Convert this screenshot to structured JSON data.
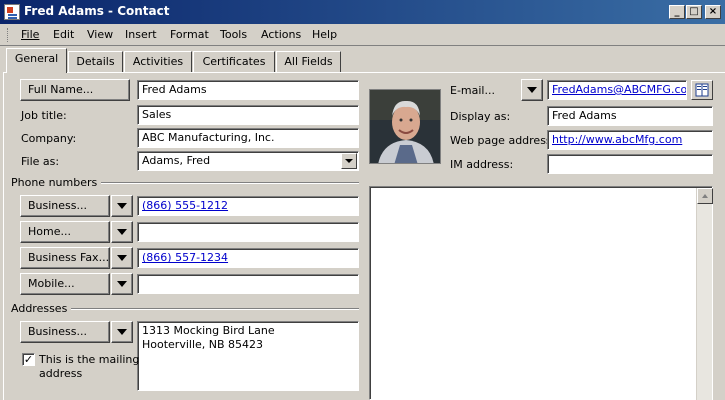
{
  "window": {
    "title": "Fred Adams - Contact",
    "min": "_",
    "max": "□",
    "close": "×"
  },
  "menu": [
    "File",
    "Edit",
    "View",
    "Insert",
    "Format",
    "Tools",
    "Actions",
    "Help"
  ],
  "tabs": [
    "General",
    "Details",
    "Activities",
    "Certificates",
    "All Fields"
  ],
  "general": {
    "full_name_btn": "Full Name...",
    "full_name": "Fred Adams",
    "job_title_label": "Job title:",
    "job_title": "Sales",
    "company_label": "Company:",
    "company": "ABC Manufacturing, Inc.",
    "file_as_label": "File as:",
    "file_as": "Adams, Fred"
  },
  "phones": {
    "section": "Phone numbers",
    "items": [
      {
        "label": "Business...",
        "value": "(866) 555-1212"
      },
      {
        "label": "Home...",
        "value": ""
      },
      {
        "label": "Business Fax...",
        "value": "(866) 557-1234"
      },
      {
        "label": "Mobile...",
        "value": ""
      }
    ]
  },
  "addresses": {
    "section": "Addresses",
    "type_btn": "Business...",
    "line1": "1313 Mocking Bird Lane",
    "line2": "Hooterville, NB 85423",
    "mailing_label_1": "This is the mailing",
    "mailing_label_2": "address",
    "mailing_checked": "✓"
  },
  "internet": {
    "email_btn": "E-mail...",
    "email": "FredAdams@ABCMFG.com",
    "display_as_label": "Display as:",
    "display_as": "Fred Adams",
    "web_label": "Web page address:",
    "web": "http://www.abcMfg.com",
    "im_label": "IM address:",
    "im": ""
  },
  "colors": {
    "titlebar_start": "#0a246a",
    "titlebar_end": "#3a6ea5",
    "link": "#0000cc"
  }
}
